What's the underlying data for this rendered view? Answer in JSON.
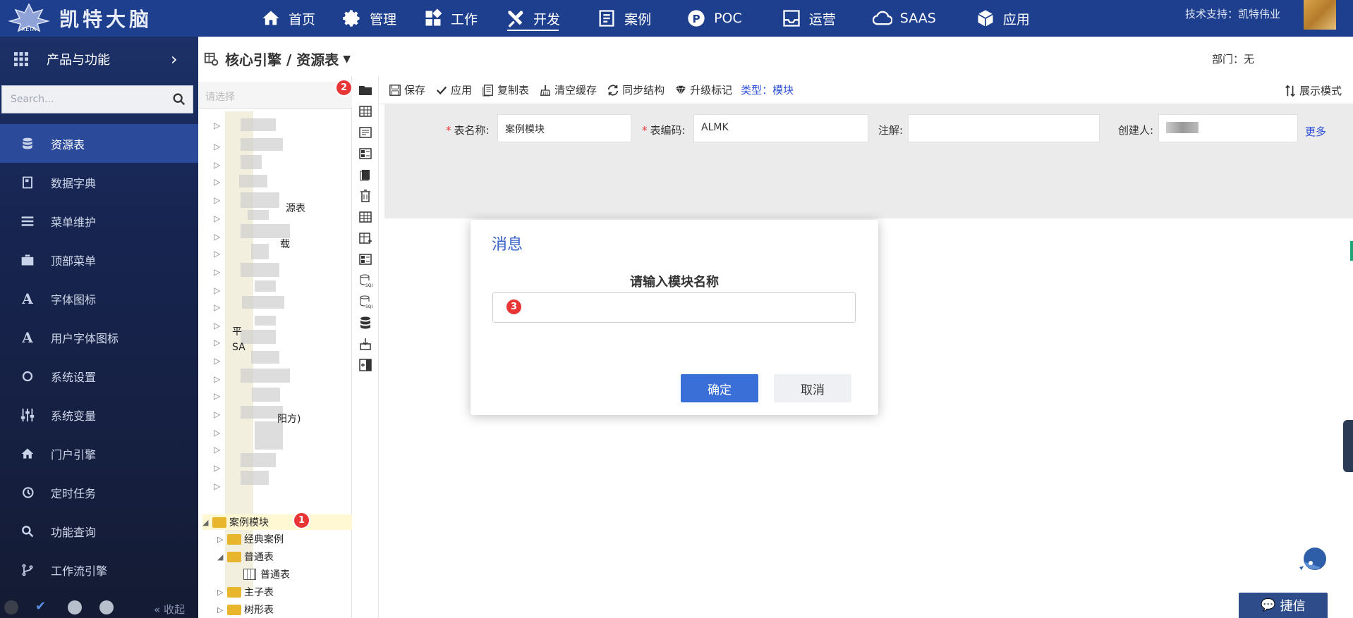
{
  "app": {
    "logo_text": "凯特大脑",
    "support": "技术支持：凯特伟业"
  },
  "nav": {
    "items": [
      {
        "label": "首页",
        "icon": "home-icon"
      },
      {
        "label": "管理",
        "icon": "gear-icon"
      },
      {
        "label": "工作",
        "icon": "grid-icon"
      },
      {
        "label": "开发",
        "icon": "tools-icon"
      },
      {
        "label": "案例",
        "icon": "case-icon"
      },
      {
        "label": "POC",
        "icon": "poc-icon"
      },
      {
        "label": "运营",
        "icon": "inbox-icon"
      },
      {
        "label": "SAAS",
        "icon": "cloud-icon"
      },
      {
        "label": "应用",
        "icon": "cube-icon"
      }
    ],
    "active": "开发"
  },
  "sidebar": {
    "header": "产品与功能",
    "search_placeholder": "Search...",
    "items": [
      {
        "label": "资源表",
        "icon": "database-icon"
      },
      {
        "label": "数据字典",
        "icon": "book-icon"
      },
      {
        "label": "菜单维护",
        "icon": "list-icon"
      },
      {
        "label": "顶部菜单",
        "icon": "briefcase-icon"
      },
      {
        "label": "字体图标",
        "icon": "font-icon"
      },
      {
        "label": "用户字体图标",
        "icon": "font-icon"
      },
      {
        "label": "系统设置",
        "icon": "circle-icon"
      },
      {
        "label": "系统变量",
        "icon": "sliders-icon"
      },
      {
        "label": "门户引擎",
        "icon": "home-icon"
      },
      {
        "label": "定时任务",
        "icon": "history-icon"
      },
      {
        "label": "功能查询",
        "icon": "search-icon"
      },
      {
        "label": "工作流引擎",
        "icon": "branch-icon"
      }
    ],
    "active": "资源表",
    "collapse_label": "« 收起"
  },
  "content": {
    "breadcrumb": "核心引擎 / 资源表",
    "dept": "部门：无"
  },
  "tree": {
    "search_placeholder": "请选择",
    "partial_labels": [
      "源表",
      "载",
      "平",
      "SA",
      "阳方)"
    ],
    "nodes": [
      {
        "label": "案例模块",
        "level": 0,
        "expanded": true,
        "selected": true
      },
      {
        "label": "经典案例",
        "level": 1,
        "expanded": false
      },
      {
        "label": "普通表",
        "level": 1,
        "expanded": true
      },
      {
        "label": "普通表",
        "level": 2,
        "leaf": true
      },
      {
        "label": "主子表",
        "level": 1,
        "expanded": false
      },
      {
        "label": "树形表",
        "level": 1,
        "expanded": false
      }
    ]
  },
  "toolbar": {
    "save": "保存",
    "apply": "应用",
    "copy": "复制表",
    "clear_cache": "清空缓存",
    "sync": "同步结构",
    "upgrade": "升级标记",
    "type_label": "类型：模块",
    "display_mode": "展示模式"
  },
  "form": {
    "table_name_label": "表名称:",
    "table_name_value": "案例模块",
    "table_code_label": "表编码:",
    "table_code_value": "ALMK",
    "comment_label": "注解:",
    "comment_value": "",
    "creator_label": "创建人:",
    "more": "更多"
  },
  "dialog": {
    "title": "消息",
    "prompt": "请输入模块名称",
    "input_value": "",
    "ok": "确定",
    "cancel": "取消"
  },
  "markers": {
    "m1": "1",
    "m2": "2",
    "m3": "3"
  },
  "chat": {
    "label": "捷信"
  },
  "colors": {
    "topbar": "#1e3f8e",
    "sidebar_active": "#2b4a9a",
    "primary_button": "#3a6fd8",
    "marker": "#e83535",
    "folder": "#e8b62c"
  }
}
